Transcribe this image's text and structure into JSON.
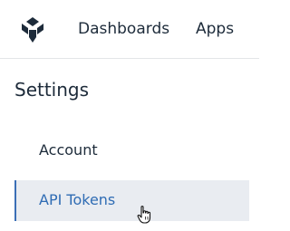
{
  "header": {
    "nav": [
      {
        "label": "Dashboards"
      },
      {
        "label": "Apps"
      }
    ]
  },
  "settings": {
    "title": "Settings",
    "items": [
      {
        "label": "Account",
        "active": false
      },
      {
        "label": "API Tokens",
        "active": true
      }
    ]
  },
  "colors": {
    "text": "#1d2b3a",
    "accent": "#2f6cb4",
    "active_bg": "#e9ecf1",
    "active_border": "#3b6fb6"
  },
  "icons": [
    "app-logo-icon",
    "hand-pointer-cursor-icon"
  ]
}
